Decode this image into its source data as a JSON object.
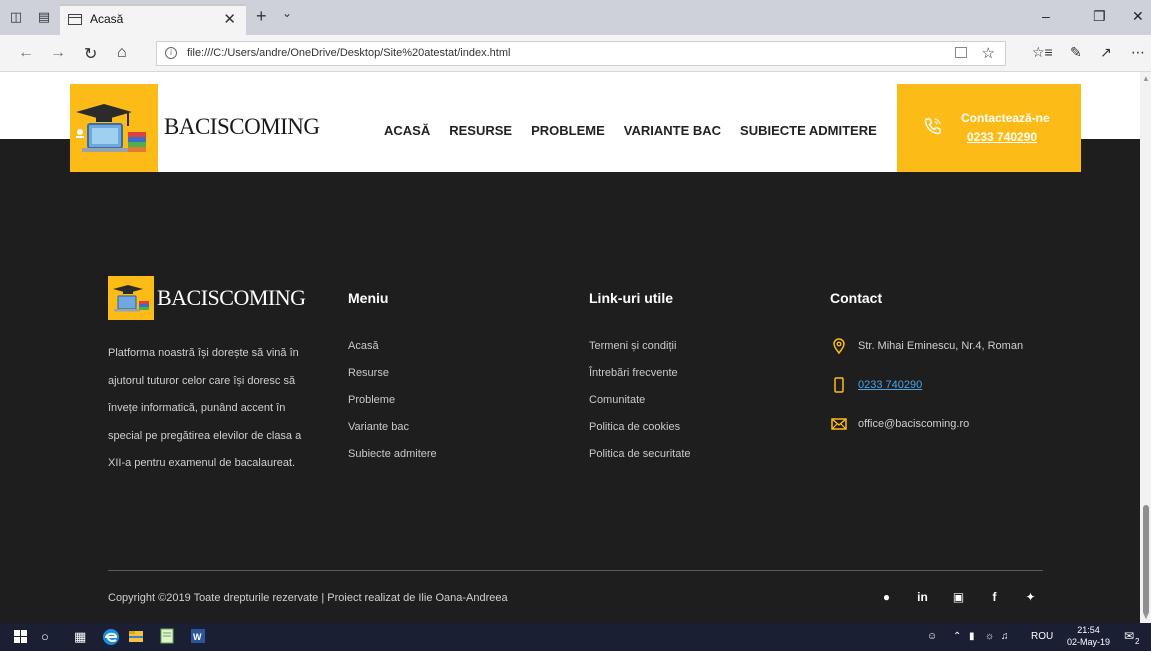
{
  "browser": {
    "tab_title": "Acasă",
    "url": "file:///C:/Users/andre/OneDrive/Desktop/Site%20atestat/index.html"
  },
  "site": {
    "brand": "BACISCOMING",
    "nav": [
      "ACASĂ",
      "RESURSE",
      "PROBLEME",
      "VARIANTE BAC",
      "SUBIECTE ADMITERE"
    ],
    "contact_cta": "Contactează-ne",
    "contact_phone": "0233 740290"
  },
  "footer": {
    "brand": "BACISCOMING",
    "about": "Platforma noastră își dorește să vină în ajutorul tuturor celor care își doresc să învețe informatică, punând accent în special pe pregătirea elevilor de clasa a XII-a pentru examenul de bacalaureat.",
    "menu_title": "Meniu",
    "menu": [
      "Acasă",
      "Resurse",
      "Probleme",
      "Variante bac",
      "Subiecte admitere"
    ],
    "links_title": "Link-uri utile",
    "links": [
      "Termeni și condiții",
      "Întrebări frecvente",
      "Comunitate",
      "Politica de cookies",
      "Politica de securitate"
    ],
    "contact_title": "Contact",
    "address": "Str. Mihai Eminescu, Nr.4, Roman",
    "phone": "0233 740290",
    "email": "office@baciscoming.ro",
    "copyright": "Copyright ©2019 Toate drepturile rezervate | Proiect realizat de Ilie Oana-Andreea",
    "socials": [
      "pinterest-icon",
      "linkedin-icon",
      "instagram-icon",
      "facebook-icon",
      "twitter-icon"
    ]
  },
  "taskbar": {
    "lang": "ROU",
    "time": "21:54",
    "date": "02-May-19",
    "notif_count": "2"
  },
  "colors": {
    "accent": "#fdbb17",
    "footer_bg": "#1e1e1e",
    "link_blue": "#4aa3e8"
  }
}
